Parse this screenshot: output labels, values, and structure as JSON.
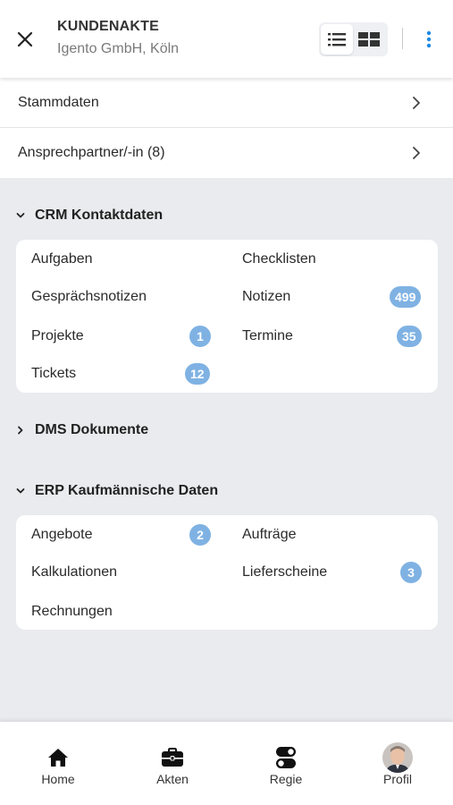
{
  "header": {
    "title": "KUNDENAKTE",
    "subtitle": "Igento GmbH, Köln",
    "close_icon": "close-icon",
    "view_modes": [
      "list-view-icon",
      "grid-view-icon"
    ],
    "active_view": "list",
    "more_icon": "more-vertical-icon"
  },
  "rows": [
    {
      "label": "Stammdaten"
    },
    {
      "label": "Ansprechpartner/-in (8)"
    }
  ],
  "sections": {
    "crm": {
      "title": "CRM Kontaktdaten",
      "expanded": true,
      "items": [
        {
          "label": "Aufgaben",
          "badge": ""
        },
        {
          "label": "Checklisten",
          "badge": ""
        },
        {
          "label": "Gesprächsnotizen",
          "badge": ""
        },
        {
          "label": "Notizen",
          "badge": "499"
        },
        {
          "label": "Projekte",
          "badge": "1"
        },
        {
          "label": "Termine",
          "badge": "35"
        },
        {
          "label": "Tickets",
          "badge": "12"
        }
      ]
    },
    "dms": {
      "title": "DMS Dokumente",
      "expanded": false
    },
    "erp": {
      "title": "ERP Kaufmännische Daten",
      "expanded": true,
      "items": [
        {
          "label": "Angebote",
          "badge": "2"
        },
        {
          "label": "Aufträge",
          "badge": ""
        },
        {
          "label": "Kalkulationen",
          "badge": ""
        },
        {
          "label": "Lieferscheine",
          "badge": "3"
        },
        {
          "label": "Rechnungen",
          "badge": ""
        }
      ]
    }
  },
  "bottom_nav": [
    {
      "label": "Home",
      "icon": "home-icon"
    },
    {
      "label": "Akten",
      "icon": "briefcase-icon"
    },
    {
      "label": "Regie",
      "icon": "toggle-icon"
    },
    {
      "label": "Profil",
      "icon": "avatar"
    }
  ],
  "colors": {
    "badge": "#7fb2e3",
    "background": "#e9ebee",
    "accent": "#1e88e5"
  }
}
